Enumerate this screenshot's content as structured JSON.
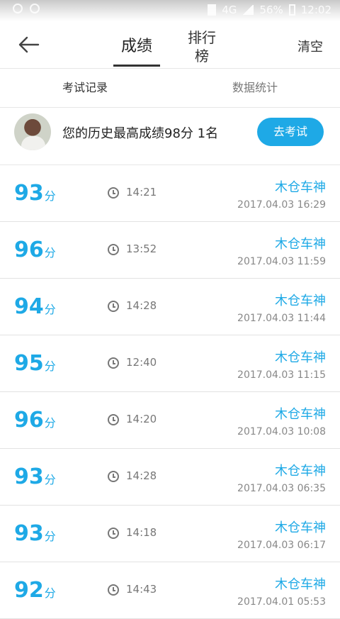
{
  "statusbar": {
    "network": "4G",
    "battery": "56%",
    "time": "12:02"
  },
  "nav": {
    "back_icon": "back-arrow-icon",
    "tab_main": "成绩",
    "tab_rank": "排行榜",
    "clear": "清空"
  },
  "subtabs": {
    "records": "考试记录",
    "stats": "数据统计"
  },
  "profile": {
    "summary": "您的历史最高成绩98分 1名",
    "button": "去考试"
  },
  "records": [
    {
      "score": "93",
      "unit": "分",
      "duration": "14:21",
      "mode": "木仓车神",
      "date": "2017.04.03  16:29"
    },
    {
      "score": "96",
      "unit": "分",
      "duration": "13:52",
      "mode": "木仓车神",
      "date": "2017.04.03  11:59"
    },
    {
      "score": "94",
      "unit": "分",
      "duration": "14:28",
      "mode": "木仓车神",
      "date": "2017.04.03  11:44"
    },
    {
      "score": "95",
      "unit": "分",
      "duration": "12:40",
      "mode": "木仓车神",
      "date": "2017.04.03  11:15"
    },
    {
      "score": "96",
      "unit": "分",
      "duration": "14:20",
      "mode": "木仓车神",
      "date": "2017.04.03  10:08"
    },
    {
      "score": "93",
      "unit": "分",
      "duration": "14:28",
      "mode": "木仓车神",
      "date": "2017.04.03  06:35"
    },
    {
      "score": "93",
      "unit": "分",
      "duration": "14:18",
      "mode": "木仓车神",
      "date": "2017.04.03  06:17"
    },
    {
      "score": "92",
      "unit": "分",
      "duration": "14:43",
      "mode": "木仓车神",
      "date": "2017.04.01  05:53"
    }
  ],
  "colors": {
    "accent": "#1ea9e6"
  }
}
